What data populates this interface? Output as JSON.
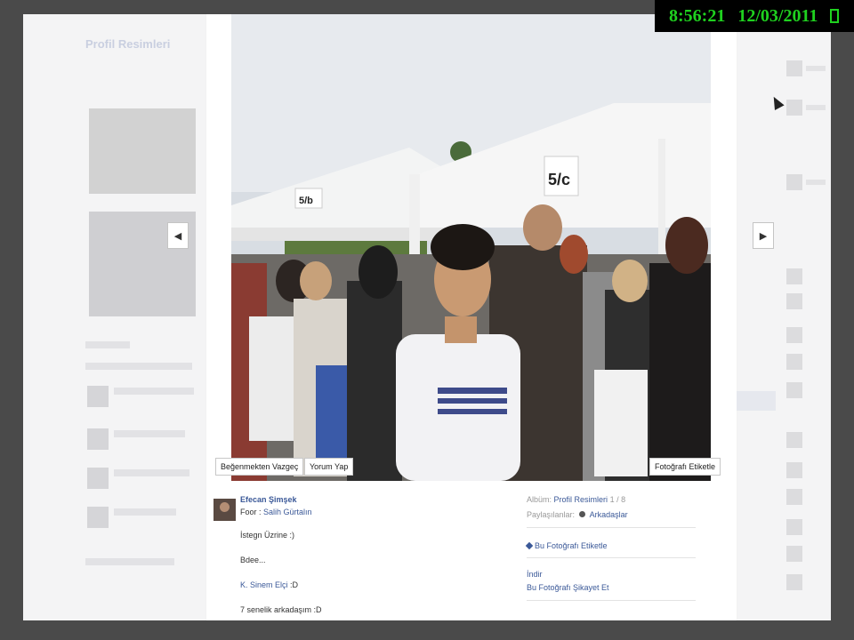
{
  "background_page": {
    "title": "Profil Resimleri"
  },
  "clock": {
    "time": "8:56:21",
    "date": "12/03/2011"
  },
  "photo_actions": {
    "unlike": "Beğenmekten Vazgeç",
    "comment": "Yorum Yap",
    "tag": "Fotoğrafı Etiketle"
  },
  "post": {
    "author": "Efecan Şimşek",
    "with_prefix": "Foor :",
    "with_name": "Salih Gürtalın",
    "line1": "İstegn Üzrine :)",
    "line2": "Bdee...",
    "line3_name": "K. Sinem Elçi",
    "line3_suffix": ":D",
    "line4": "7 senelik arkadaşım :D"
  },
  "meta": {
    "album_label": "Albüm:",
    "album_name": "Profil Resimleri",
    "album_count": "1 / 8",
    "shared_label": "Paylaşılanlar:",
    "shared_with": "Arkadaşlar",
    "tag_photo": "Bu Fotoğrafı Etiketle",
    "download": "İndir",
    "report": "Bu Fotoğrafı Şikayet Et"
  },
  "icons": {
    "left_arrow": "◀",
    "right_arrow": "▶"
  }
}
